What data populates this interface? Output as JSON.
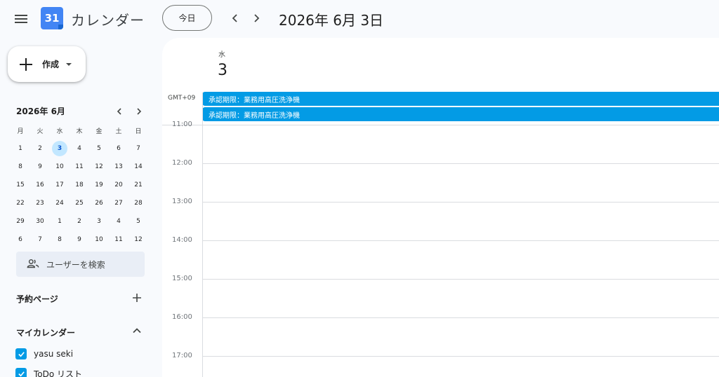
{
  "app": {
    "title": "カレンダー",
    "logo_number": "31"
  },
  "header": {
    "today_label": "今日",
    "date_heading": "2026年 6月 3日"
  },
  "sidebar": {
    "create_label": "作成",
    "mini_calendar": {
      "title": "2026年 6月",
      "weekdays": [
        "月",
        "火",
        "水",
        "木",
        "金",
        "土",
        "日"
      ],
      "days": [
        "1",
        "2",
        "3",
        "4",
        "5",
        "6",
        "7",
        "8",
        "9",
        "10",
        "11",
        "12",
        "13",
        "14",
        "15",
        "16",
        "17",
        "18",
        "19",
        "20",
        "21",
        "22",
        "23",
        "24",
        "25",
        "26",
        "27",
        "28",
        "29",
        "30",
        "1",
        "2",
        "3",
        "4",
        "5",
        "6",
        "7",
        "8",
        "9",
        "10",
        "11",
        "12"
      ],
      "selected_index": 2
    },
    "user_search_label": "ユーザーを検索",
    "booking_pages_label": "予約ページ",
    "my_calendars_label": "マイカレンダー",
    "calendars": [
      {
        "name": "yasu seki",
        "checked": true,
        "color": "#039be5"
      },
      {
        "name": "ToDo リスト",
        "checked": true,
        "color": "#039be5"
      }
    ]
  },
  "day_view": {
    "weekday": "水",
    "day_number": "3",
    "timezone": "GMT+09",
    "all_day_events": [
      "承認期限：業務用高圧洗浄機",
      "承認期限：業務用高圧洗浄機"
    ],
    "hours": [
      "11:00",
      "12:00",
      "13:00",
      "14:00",
      "15:00",
      "16:00",
      "17:00"
    ],
    "event_color": "#039be5"
  }
}
